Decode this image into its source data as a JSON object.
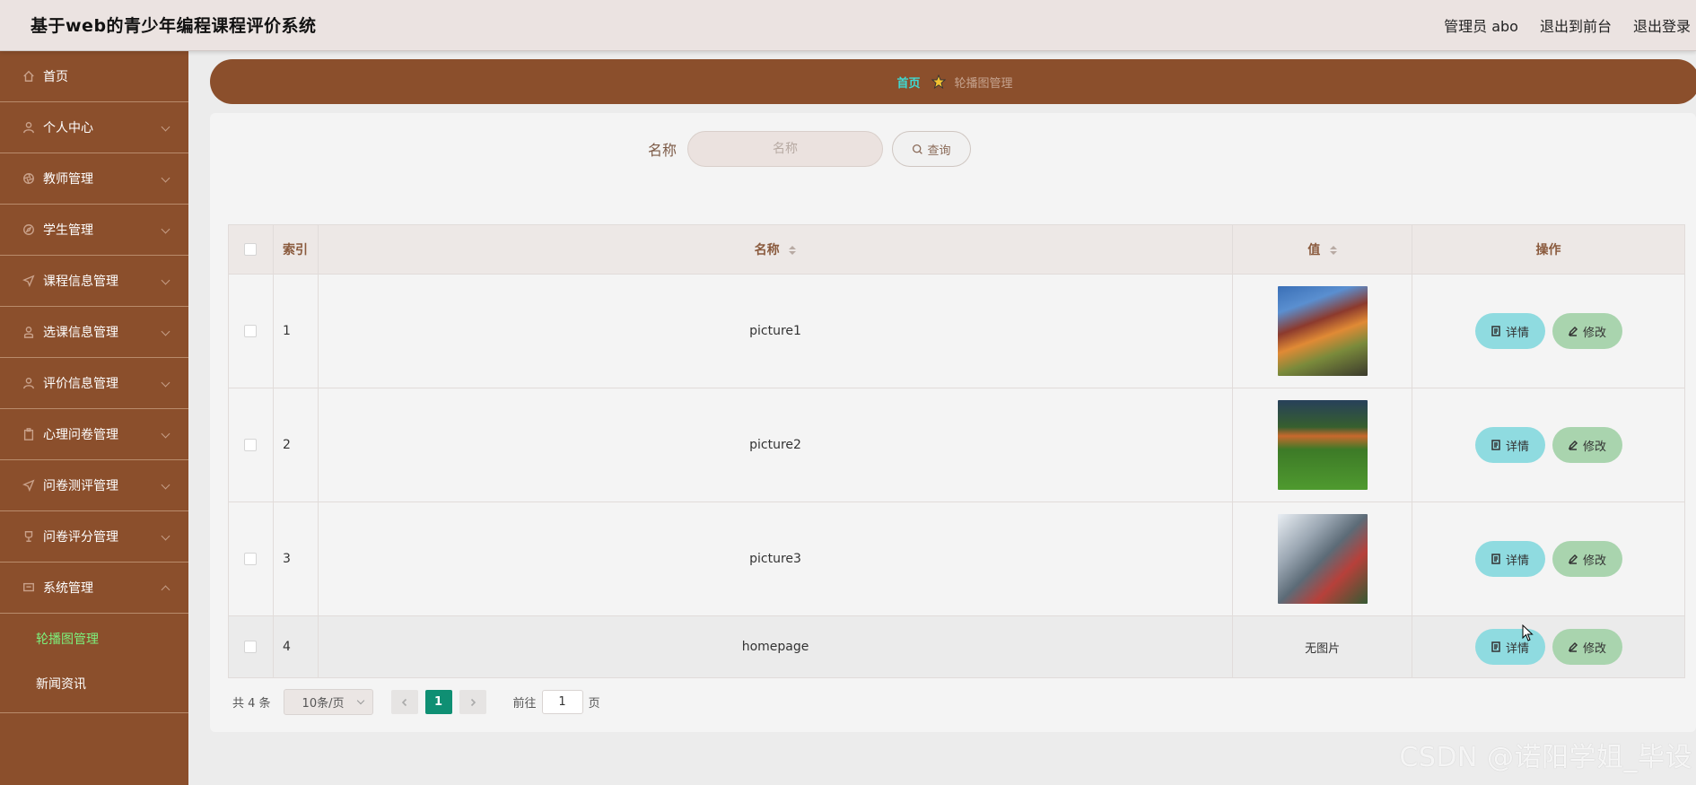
{
  "header": {
    "title": "基于web的青少年编程课程评价系统",
    "admin_label": "管理员 abo",
    "frontend_label": "退出到前台",
    "logout_label": "退出登录"
  },
  "sidebar": {
    "items": [
      {
        "label": "首页",
        "icon": "home-icon"
      },
      {
        "label": "个人中心",
        "icon": "person-icon"
      },
      {
        "label": "教师管理",
        "icon": "aperture-icon"
      },
      {
        "label": "学生管理",
        "icon": "compass-icon"
      },
      {
        "label": "课程信息管理",
        "icon": "send-icon"
      },
      {
        "label": "选课信息管理",
        "icon": "user-icon"
      },
      {
        "label": "评价信息管理",
        "icon": "person-icon"
      },
      {
        "label": "心理问卷管理",
        "icon": "clipboard-icon"
      },
      {
        "label": "问卷测评管理",
        "icon": "send-icon"
      },
      {
        "label": "问卷评分管理",
        "icon": "trophy-icon"
      },
      {
        "label": "系统管理",
        "icon": "monitor-icon"
      }
    ],
    "submenu": [
      {
        "label": "轮播图管理",
        "active": true
      },
      {
        "label": "新闻资讯",
        "active": false
      }
    ]
  },
  "breadcrumb": {
    "home": "首页",
    "current": "轮播图管理"
  },
  "search": {
    "label": "名称",
    "placeholder": "名称",
    "button": "查询"
  },
  "table": {
    "headers": {
      "index": "索引",
      "name": "名称",
      "value": "值",
      "actions": "操作"
    },
    "rows": [
      {
        "index": "1",
        "name": "picture1",
        "value": "image"
      },
      {
        "index": "2",
        "name": "picture2",
        "value": "image"
      },
      {
        "index": "3",
        "name": "picture3",
        "value": "image"
      },
      {
        "index": "4",
        "name": "homepage",
        "value": "无图片"
      }
    ],
    "detail_label": "详情",
    "edit_label": "修改"
  },
  "pagination": {
    "total": "共 4 条",
    "page_size": "10条/页",
    "current_page": "1",
    "goto_prefix": "前往",
    "goto_value": "1",
    "goto_suffix": "页"
  },
  "watermark": "CSDN @诺阳学姐_毕设",
  "colors": {
    "sidebar": "#8b4f2c",
    "header": "#ebe3e1",
    "accent": "#0f8f73",
    "detail_button": "#8fdbe0",
    "edit_button": "#a9d4ae",
    "submenu_active": "#7cf17c"
  }
}
